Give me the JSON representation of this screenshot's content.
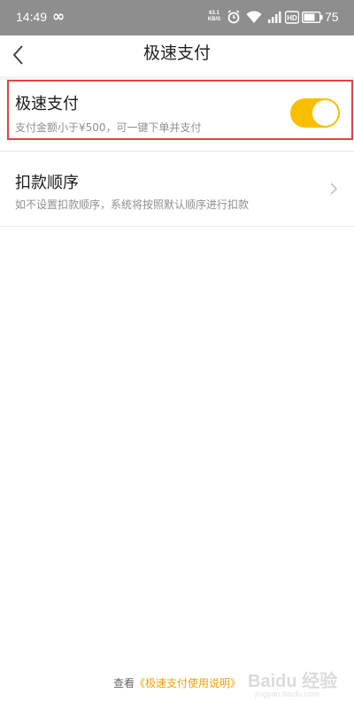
{
  "status_bar": {
    "time": "14:49",
    "infinity_glyph": "∞",
    "net_speed_value": "63.1",
    "net_speed_unit": "KB/S",
    "battery": "75"
  },
  "nav": {
    "title": "极速支付"
  },
  "fast_pay": {
    "title": "极速支付",
    "subtitle": "支付金额小于¥500，可一键下单并支付",
    "enabled": true,
    "accent_color": "#fabe00"
  },
  "deduction_order": {
    "title": "扣款顺序",
    "subtitle": "如不设置扣款顺序，系统将按照默认顺序进行扣款"
  },
  "footer": {
    "prefix": "查看",
    "link": "《极速支付使用说明》"
  },
  "watermark": {
    "text": "Baidu 经验",
    "sub": "jingyan.baidu.com"
  }
}
